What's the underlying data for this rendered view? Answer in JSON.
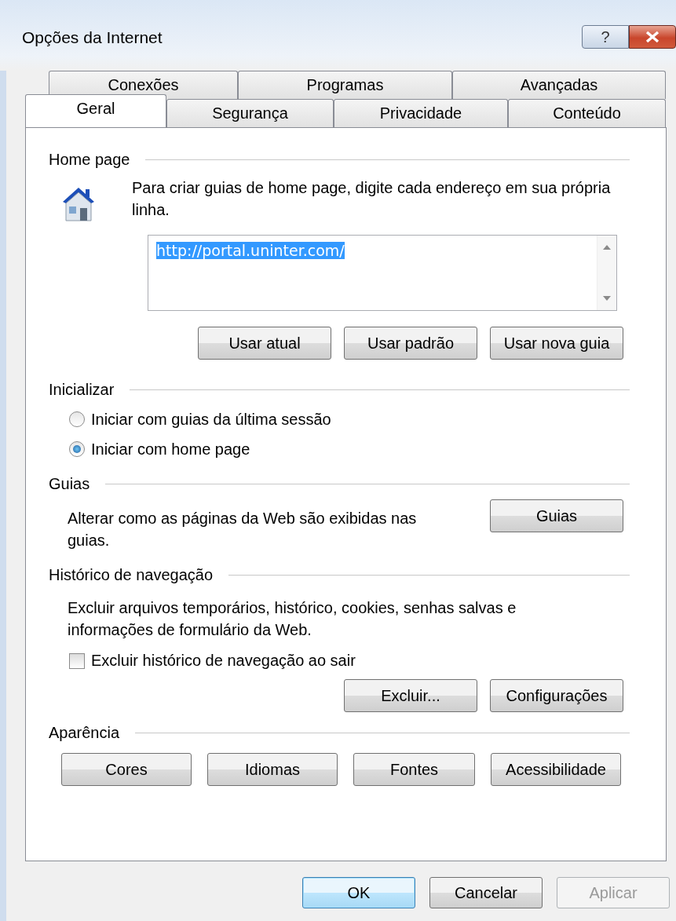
{
  "window": {
    "title": "Opções da Internet",
    "help_button": "?"
  },
  "tab_rows": [
    [
      {
        "label": "Conexões",
        "selected": false
      },
      {
        "label": "Programas",
        "selected": false
      },
      {
        "label": "Avançadas",
        "selected": false
      }
    ],
    [
      {
        "label": "Geral",
        "selected": true
      },
      {
        "label": "Segurança",
        "selected": false
      },
      {
        "label": "Privacidade",
        "selected": false
      },
      {
        "label": "Conteúdo",
        "selected": false
      }
    ]
  ],
  "home_page": {
    "heading": "Home page",
    "description": "Para criar guias de home page, digite cada endereço em sua própria linha.",
    "addresses": "http://portal.uninter.com/",
    "text_selected": true,
    "buttons": [
      "Usar atual",
      "Usar padrão",
      "Usar nova guia"
    ]
  },
  "startup": {
    "heading": "Inicializar",
    "options": [
      {
        "label": "Iniciar com guias da última sessão",
        "selected": false
      },
      {
        "label": "Iniciar com home page",
        "selected": true
      }
    ]
  },
  "tabs_section": {
    "heading": "Guias",
    "description": "Alterar como as páginas da Web são exibidas nas guias.",
    "button": "Guias"
  },
  "history": {
    "heading": "Histórico de navegação",
    "description": "Excluir arquivos temporários, histórico, cookies, senhas salvas e informações de formulário da Web.",
    "checkbox": {
      "label": "Excluir histórico de navegação ao sair",
      "checked": false
    },
    "buttons": [
      "Excluir...",
      "Configurações"
    ]
  },
  "appearance": {
    "heading": "Aparência",
    "buttons": [
      "Cores",
      "Idiomas",
      "Fontes",
      "Acessibilidade"
    ]
  },
  "footer_buttons": [
    {
      "label": "OK",
      "kind": "default",
      "disabled": false
    },
    {
      "label": "Cancelar",
      "kind": "normal",
      "disabled": false
    },
    {
      "label": "Aplicar",
      "kind": "normal",
      "disabled": true
    }
  ]
}
